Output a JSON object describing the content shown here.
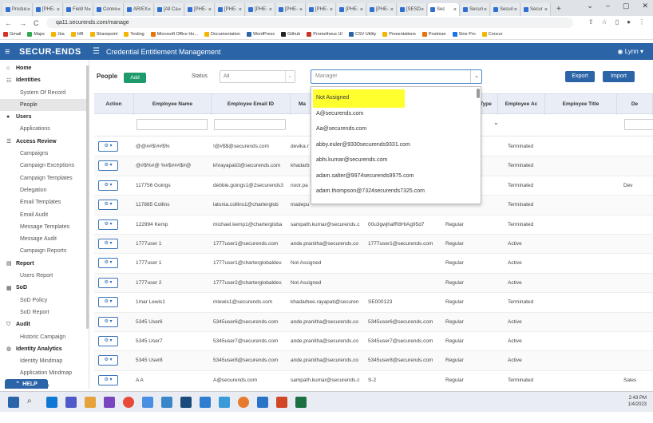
{
  "browser": {
    "tabs": [
      "Produc",
      "[PHE-",
      "Field N",
      "Conne",
      "AR/EX",
      "[All Ca",
      "[PHE-",
      "[PHE-",
      "[PHE-",
      "[PHE-",
      "[PHE-",
      "[PHE-",
      "[PHE-",
      "[SESD",
      "Sec",
      "Securi",
      "Securi",
      "Secur"
    ],
    "active_tab_index": 14,
    "url": "qa11.securends.com/manage",
    "bookmarks": [
      "Gmail",
      "Maps",
      "Jira",
      "HR",
      "Sharepoint",
      "Testing",
      "Microsoft Office Ho...",
      "Documentation",
      "WordPress",
      "Github",
      "Prometheus UI",
      "CSV Utility",
      "Presentations",
      "Postman",
      "Sine Pro",
      "Concur"
    ]
  },
  "app": {
    "logo": "SECUR-ENDS",
    "title": "Credential Entitlement Management",
    "user": "Lynn"
  },
  "sidebar": {
    "sections": [
      {
        "label": "Home",
        "icon": "home-icon",
        "items": []
      },
      {
        "label": "Identities",
        "icon": "identities-icon",
        "items": [
          "System Of Record",
          "People"
        ]
      },
      {
        "label": "Users",
        "icon": "user-icon",
        "items": [
          "Applications"
        ]
      },
      {
        "label": "Access Review",
        "icon": "access-review-icon",
        "items": [
          "Campaigns",
          "Campaign Exceptions",
          "Campaign Templates",
          "Delegation",
          "Email Templates",
          "Email Audit",
          "Message Templates",
          "Message Audit",
          "Campaign Reports"
        ]
      },
      {
        "label": "Report",
        "icon": "report-icon",
        "items": [
          "Users Report"
        ]
      },
      {
        "label": "SoD",
        "icon": "sod-icon",
        "items": [
          "SoD Policy",
          "SoD Report"
        ]
      },
      {
        "label": "Audit",
        "icon": "audit-icon",
        "items": [
          "Historic Campaign"
        ]
      },
      {
        "label": "Identity Analytics",
        "icon": "analytics-icon",
        "items": [
          "Identity Mindmap",
          "Application Mindmap",
          "nt Mindmap"
        ]
      }
    ],
    "selected_item": "People",
    "help_label": "HELP"
  },
  "toolbar": {
    "people_label": "People",
    "add_label": "Add",
    "status_label": "Status",
    "status_value": "All",
    "manager_placeholder": "Manager",
    "export_label": "Export",
    "import_label": "Import"
  },
  "table": {
    "columns": [
      "Action",
      "Employee Name",
      "Employee Email ID",
      "Ma",
      "Type",
      "Employee Ac",
      "Employee Title",
      "De"
    ],
    "rows": [
      {
        "name": "@@##$!##$%",
        "email": "!@#$$@securends.com",
        "manager": "devika.r",
        "mgr_email": "",
        "type": "",
        "status": "Terminated",
        "title": "",
        "dept": ""
      },
      {
        "name": "@#$%#@ %#$###$#@",
        "email": "khrayapati3@securends.com",
        "manager": "khadarb",
        "mgr_email": "",
        "type": "",
        "status": "Terminated",
        "title": "",
        "dept": ""
      },
      {
        "name": "117756 Goings",
        "email": "debbie.goings1@2securends3",
        "manager": "noor.pa",
        "mgr_email": "",
        "type": "",
        "status": "Terminated",
        "title": "",
        "dept": "Dev"
      },
      {
        "name": "117885 Collins",
        "email": "latonia.collins1@charterglob",
        "manager": "madepu",
        "mgr_email": "",
        "type": "",
        "status": "Terminated",
        "title": "",
        "dept": ""
      },
      {
        "name": "122994 Kemp",
        "email": "michael.kemp1@chartergloba",
        "manager": "sampath.kumar@securends.c",
        "mgr_email": "00u3gwjhafR8HIAg95d7",
        "type": "Regular",
        "status": "Terminated",
        "title": "",
        "dept": ""
      },
      {
        "name": "1777user 1",
        "email": "1777user1@securends.com",
        "manager": "ande.pranitha@securends.co",
        "mgr_email": "1777user1@securends.com",
        "type": "Regular",
        "status": "Active",
        "title": "",
        "dept": ""
      },
      {
        "name": "1777user 1",
        "email": "1777user1@charterglobaldev.",
        "manager": "Not Assigned",
        "mgr_email": "",
        "type": "Regular",
        "status": "Active",
        "title": "",
        "dept": ""
      },
      {
        "name": "1777user 2",
        "email": "1777user2@charterglobaldev.",
        "manager": "Not Assigned",
        "mgr_email": "",
        "type": "Regular",
        "status": "Active",
        "title": "",
        "dept": ""
      },
      {
        "name": "1mar Lewis1",
        "email": "mlewis1@securends.com",
        "manager": "khadarbee.rayapati@securen",
        "mgr_email": "SE000123",
        "type": "Regular",
        "status": "Terminated",
        "title": "",
        "dept": ""
      },
      {
        "name": "5345 User6",
        "email": "5345user6@securends.com",
        "manager": "ande.pranitha@securends.co",
        "mgr_email": "5345user6@securends.com",
        "type": "Regular",
        "status": "Active",
        "title": "",
        "dept": ""
      },
      {
        "name": "5345 User7",
        "email": "5345user7@securends.com",
        "manager": "ande.pranitha@securends.co",
        "mgr_email": "5345user7@securends.com",
        "type": "Regular",
        "status": "Active",
        "title": "",
        "dept": ""
      },
      {
        "name": "5345 User8",
        "email": "5345user8@securends.com",
        "manager": "ande.pranitha@securends.co",
        "mgr_email": "5345user8@securends.com",
        "type": "Regular",
        "status": "Active",
        "title": "",
        "dept": ""
      },
      {
        "name": "A A",
        "email": "A@securends.com",
        "manager": "sampath.kumar@securends.c",
        "mgr_email": "S-2",
        "type": "Regular",
        "status": "Terminated",
        "title": "",
        "dept": "Sales"
      }
    ]
  },
  "manager_dropdown": {
    "options": [
      "Not Assigned",
      "A@securends.com",
      "Aa@securends.com",
      "abby.euler@9330securends9331.com",
      "abhi.kumar@securends.com",
      "adam.salter@9974securends9975.com",
      "adam.thompson@7324securends7325.com"
    ],
    "highlighted": "Not Assigned",
    "highlight_color": "#ffff2e"
  },
  "taskbar": {
    "time": "2:43 PM",
    "date": "1/4/2023"
  }
}
